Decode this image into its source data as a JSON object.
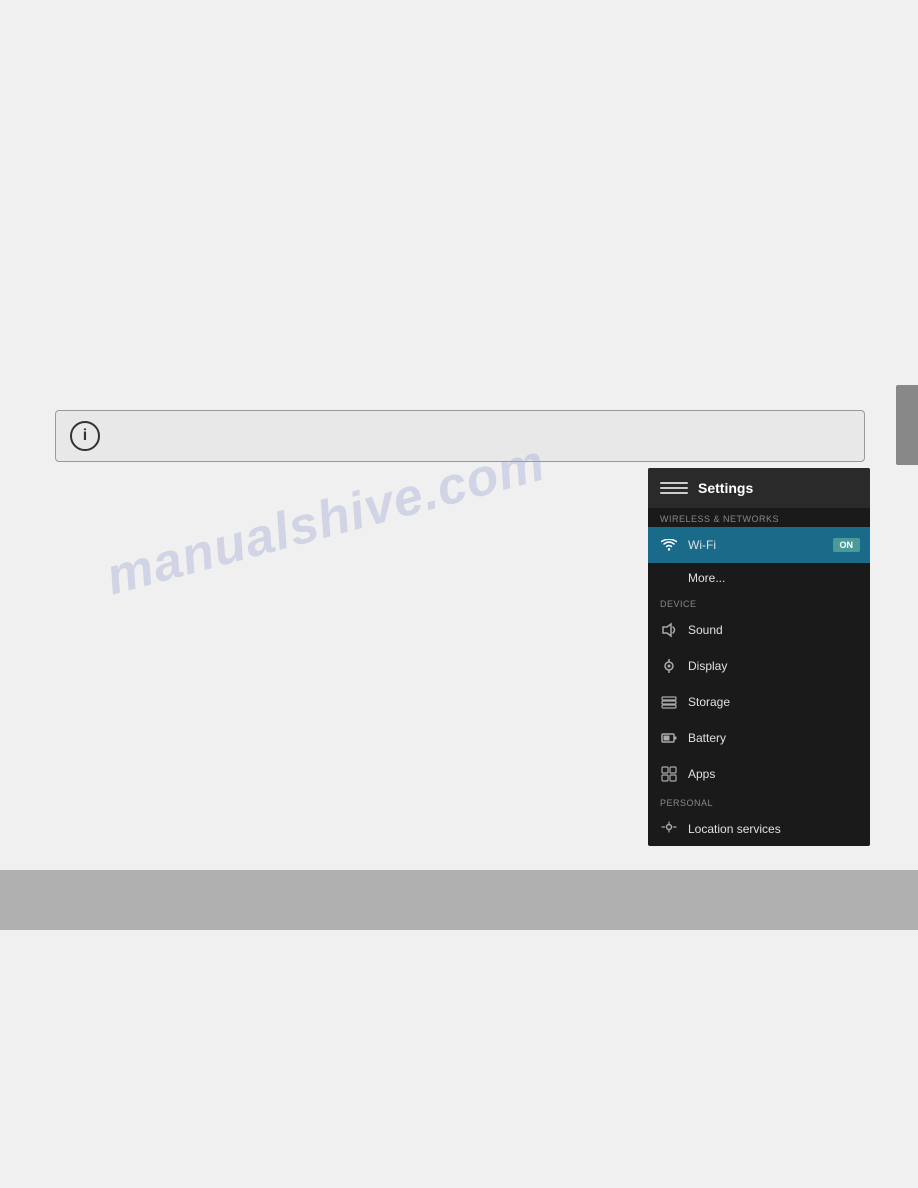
{
  "page": {
    "background_top": "#f0f0f0",
    "background_bottom": "#f0f0f0",
    "bar_color": "#b0b0b0",
    "watermark": "manualshive.com"
  },
  "info_bar": {
    "icon": "i"
  },
  "settings": {
    "title": "Settings",
    "sections": [
      {
        "label": "WIRELESS & NETWORKS",
        "items": [
          {
            "id": "wifi",
            "label": "Wi-Fi",
            "icon": "wifi",
            "active": true,
            "toggle": "ON"
          },
          {
            "id": "more",
            "label": "More...",
            "icon": null,
            "active": false,
            "toggle": null
          }
        ]
      },
      {
        "label": "DEVICE",
        "items": [
          {
            "id": "sound",
            "label": "Sound",
            "icon": "sound",
            "active": false,
            "toggle": null
          },
          {
            "id": "display",
            "label": "Display",
            "icon": "display",
            "active": false,
            "toggle": null
          },
          {
            "id": "storage",
            "label": "Storage",
            "icon": "storage",
            "active": false,
            "toggle": null
          },
          {
            "id": "battery",
            "label": "Battery",
            "icon": "battery",
            "active": false,
            "toggle": null
          },
          {
            "id": "apps",
            "label": "Apps",
            "icon": "apps",
            "active": false,
            "toggle": null
          }
        ]
      },
      {
        "label": "PERSONAL",
        "items": [
          {
            "id": "location",
            "label": "Location services",
            "icon": "location",
            "active": false,
            "toggle": null
          }
        ]
      }
    ],
    "nav": {
      "back": "←",
      "home": "⌂",
      "recents": "▭"
    }
  }
}
